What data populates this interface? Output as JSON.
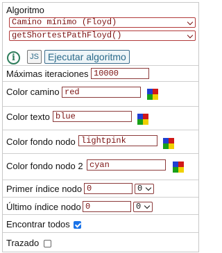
{
  "algorithm": {
    "label": "Algoritmo",
    "selected": "Camino mínimo (Floyd)",
    "method_selected": "getShortestPathFloyd()"
  },
  "toolbar": {
    "js_label": "JS",
    "run_label": "Ejecutar algoritmo",
    "info_glyph": "i"
  },
  "fields": {
    "max_iterations": {
      "label": "Máximas iteraciones",
      "value": "10000"
    },
    "path_color": {
      "label": "Color camino",
      "value": "red"
    },
    "text_color": {
      "label": "Color texto",
      "value": "blue"
    },
    "node_bg_color": {
      "label": "Color fondo nodo",
      "value": "lightpink"
    },
    "node_bg_color_2": {
      "label": "Color fondo nodo 2",
      "value": "cyan"
    },
    "first_node_index": {
      "label": "Primer índice nodo",
      "value": "0",
      "select_value": "0"
    },
    "last_node_index": {
      "label": "Último índice nodo",
      "value": "0",
      "select_value": "0"
    },
    "find_all": {
      "label": "Encontrar todos",
      "checked": true
    },
    "trace": {
      "label": "Trazado",
      "checked": false
    }
  },
  "palette_colors": [
    "#1f3fd1",
    "#d01818",
    "#18a018",
    "#f0d000"
  ]
}
